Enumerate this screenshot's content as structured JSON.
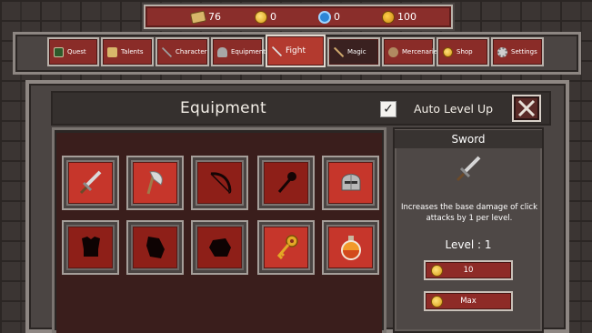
{
  "currencies": {
    "scrolls": "76",
    "coins": "0",
    "essence": "0",
    "gold": "100"
  },
  "tabs": [
    {
      "label": "Quest",
      "icon": "quest-book-icon"
    },
    {
      "label": "Talents",
      "icon": "talents-scroll-icon"
    },
    {
      "label": "Character",
      "icon": "character-pickaxe-icon"
    },
    {
      "label": "Equipment",
      "icon": "equipment-helmet-icon"
    },
    {
      "label": "Fight",
      "icon": "fight-sword-icon"
    },
    {
      "label": "Magic",
      "icon": "magic-wand-icon"
    },
    {
      "label": "Mercenaries",
      "icon": "mercenaries-icon"
    },
    {
      "label": "Shop",
      "icon": "shop-coin-icon"
    },
    {
      "label": "Settings",
      "icon": "settings-gear-icon"
    }
  ],
  "active_tab": "Fight",
  "panel": {
    "title": "Equipment",
    "auto_level_label": "Auto Level Up",
    "auto_level_checked": "✓"
  },
  "items": [
    {
      "name": "sword",
      "state": "unlocked"
    },
    {
      "name": "axe",
      "state": "unlocked"
    },
    {
      "name": "bow",
      "state": "silhouette"
    },
    {
      "name": "mace",
      "state": "silhouette"
    },
    {
      "name": "helmet",
      "state": "unlocked"
    },
    {
      "name": "armor",
      "state": "locked"
    },
    {
      "name": "gem",
      "state": "locked"
    },
    {
      "name": "rock",
      "state": "locked"
    },
    {
      "name": "key",
      "state": "unlocked"
    },
    {
      "name": "potion",
      "state": "unlocked"
    }
  ],
  "details": {
    "name": "Sword",
    "description": "Increases the base damage of click attacks by 1 per level.",
    "level": "Level : 1",
    "cost_label": "10",
    "max_label": "Max"
  },
  "colors": {
    "tab_red": "#8a2c28",
    "slot_red": "#c6362b",
    "frame_gray": "#8e8783"
  }
}
